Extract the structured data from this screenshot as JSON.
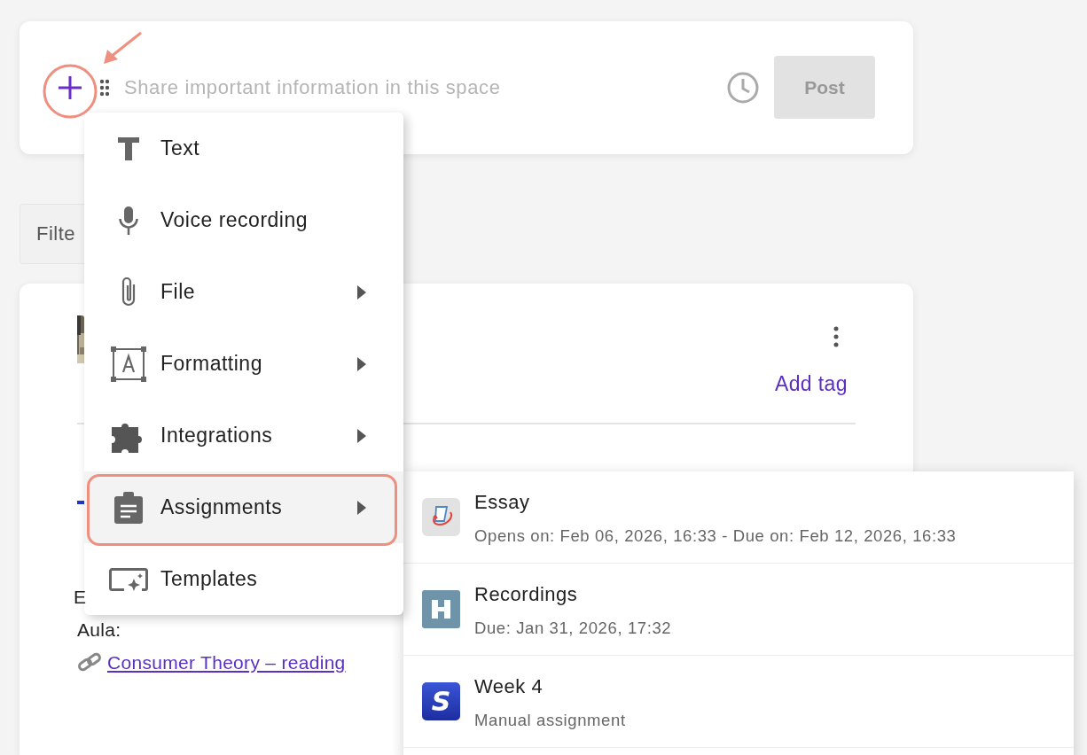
{
  "composer": {
    "placeholder": "Share important information in this space",
    "post_button": "Post",
    "post_disabled": true,
    "add_button_annotated": true
  },
  "filter": {
    "label": "Filte"
  },
  "post": {
    "add_tag": "Add tag",
    "lines": [
      "E",
      "Aula:"
    ],
    "link": "Consumer Theory – reading"
  },
  "menu": {
    "items": [
      {
        "label": "Text",
        "submenu": false,
        "selected": false,
        "annotated": false
      },
      {
        "label": "Voice recording",
        "submenu": false,
        "selected": false,
        "annotated": false
      },
      {
        "label": "File",
        "submenu": true,
        "selected": false,
        "annotated": false
      },
      {
        "label": "Formatting",
        "submenu": true,
        "selected": false,
        "annotated": false
      },
      {
        "label": "Integrations",
        "submenu": true,
        "selected": false,
        "annotated": false
      },
      {
        "label": "Assignments",
        "submenu": true,
        "selected": true,
        "annotated": true
      },
      {
        "label": "Templates",
        "submenu": false,
        "selected": false,
        "annotated": false
      }
    ]
  },
  "submenu": {
    "items": [
      {
        "title": "Essay",
        "detail": "Opens on: Feb 06, 2026, 16:33 - Due on: Feb 12, 2026, 16:33"
      },
      {
        "title": "Recordings",
        "detail": "Due: Jan 31, 2026, 17:32"
      },
      {
        "title": "Week 4",
        "detail": "Manual assignment",
        "icon_letter": "S"
      }
    ]
  }
}
